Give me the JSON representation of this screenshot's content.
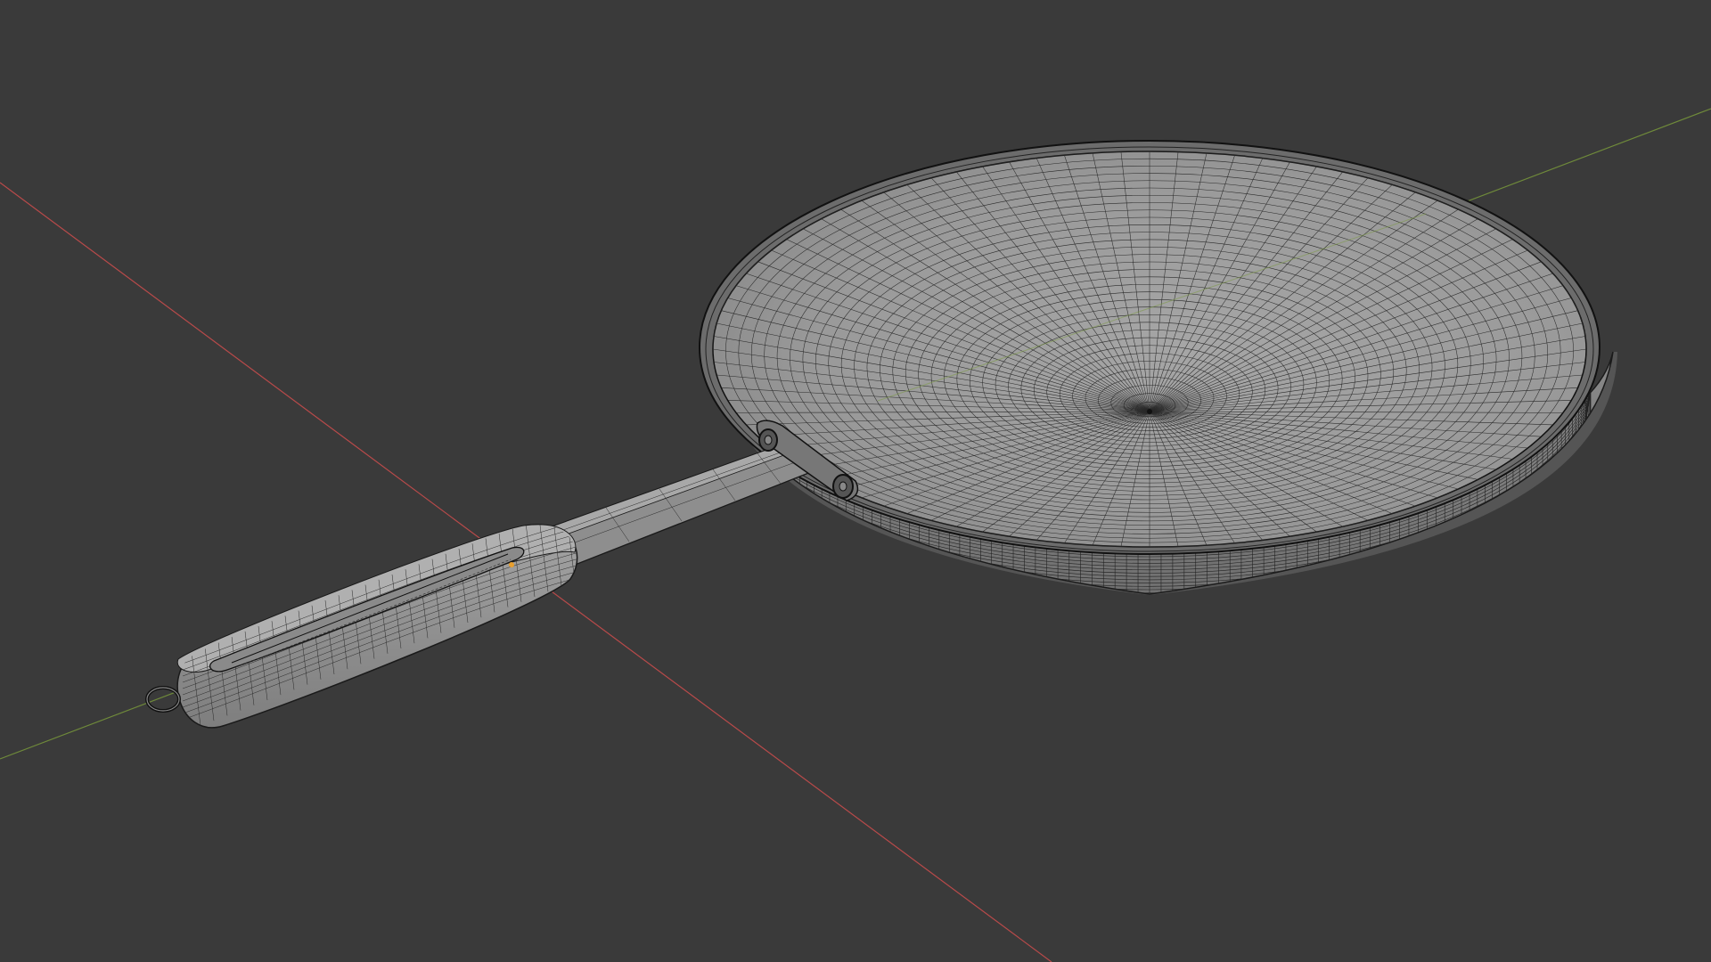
{
  "viewport": {
    "background": "#3a3a3a",
    "x_axis_color": "#b84a4a",
    "y_axis_color": "#6f8a3a",
    "mesh_fill": "#9c9c9c",
    "mesh_shade": "#7a7a7a",
    "wire_color": "#1a1a1a",
    "origin_color": "#e8a030"
  },
  "objects": [
    {
      "name": "frying-pan",
      "parts": [
        "pan-body",
        "handle-shaft",
        "handle-grip",
        "hanging-ring",
        "rivets"
      ]
    }
  ]
}
